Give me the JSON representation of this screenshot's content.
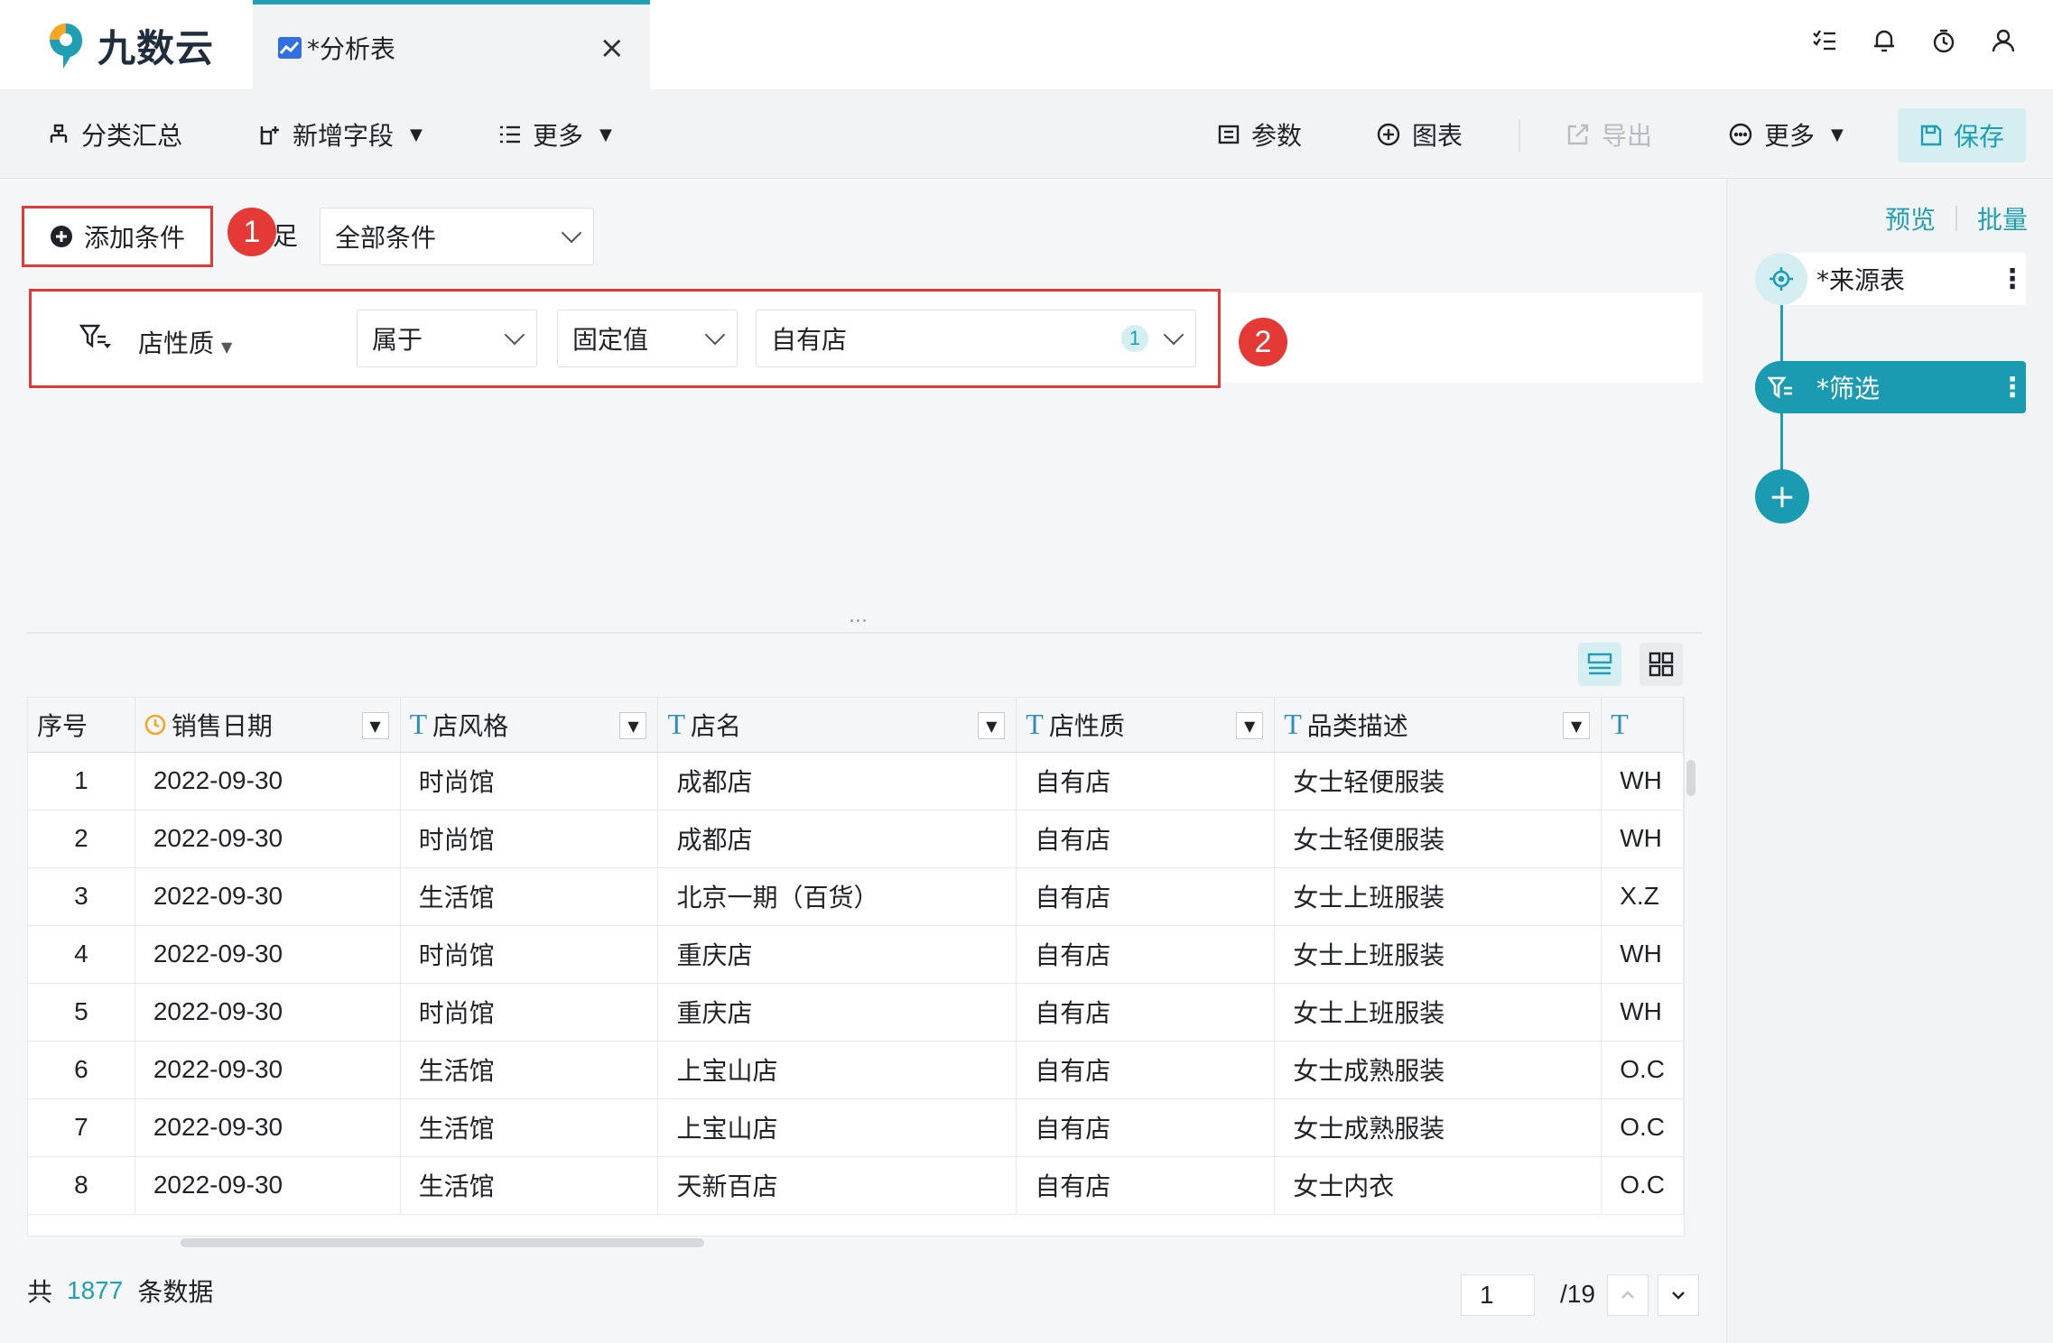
{
  "app": {
    "name": "九数云"
  },
  "tab": {
    "title": "*分析表"
  },
  "toolbar": {
    "group_summary": "分类汇总",
    "add_field": "新增字段",
    "more_left": "更多",
    "params": "参数",
    "chart": "图表",
    "export": "导出",
    "more_right": "更多",
    "save": "保存"
  },
  "filter": {
    "add_condition": "添加条件",
    "satisfy_partial": "足",
    "match_mode": "全部条件",
    "condition": {
      "field": "店性质",
      "operator": "属于",
      "value_type": "固定值",
      "value": "自有店",
      "value_count": "1"
    },
    "annotations": [
      "1",
      "2"
    ],
    "resizer": "..."
  },
  "table": {
    "columns": [
      {
        "label": "序号",
        "type": ""
      },
      {
        "label": "销售日期",
        "type": "date"
      },
      {
        "label": "店风格",
        "type": "T"
      },
      {
        "label": "店名",
        "type": "T"
      },
      {
        "label": "店性质",
        "type": "T"
      },
      {
        "label": "品类描述",
        "type": "T"
      },
      {
        "label": "",
        "type": "T"
      }
    ],
    "rows": [
      [
        "1",
        "2022-09-30",
        "时尚馆",
        "成都店",
        "自有店",
        "女士轻便服装",
        "WH"
      ],
      [
        "2",
        "2022-09-30",
        "时尚馆",
        "成都店",
        "自有店",
        "女士轻便服装",
        "WH"
      ],
      [
        "3",
        "2022-09-30",
        "生活馆",
        "北京一期（百货）",
        "自有店",
        "女士上班服装",
        "X.Z"
      ],
      [
        "4",
        "2022-09-30",
        "时尚馆",
        "重庆店",
        "自有店",
        "女士上班服装",
        "WH"
      ],
      [
        "5",
        "2022-09-30",
        "时尚馆",
        "重庆店",
        "自有店",
        "女士上班服装",
        "WH"
      ],
      [
        "6",
        "2022-09-30",
        "生活馆",
        "上宝山店",
        "自有店",
        "女士成熟服装",
        "O.C"
      ],
      [
        "7",
        "2022-09-30",
        "生活馆",
        "上宝山店",
        "自有店",
        "女士成熟服装",
        "O.C"
      ],
      [
        "8",
        "2022-09-30",
        "生活馆",
        "天新百店",
        "自有店",
        "女士内衣",
        "O.C"
      ]
    ]
  },
  "footer": {
    "prefix": "共",
    "count": "1877",
    "suffix": "条数据",
    "page": "1",
    "total_pages": "/19"
  },
  "right_panel": {
    "preview": "预览",
    "batch": "批量",
    "nodes": [
      {
        "label": "*来源表",
        "active": false
      },
      {
        "label": "*筛选",
        "active": true
      }
    ],
    "add": "+"
  },
  "colors": {
    "accent": "#1f9fb3",
    "annotation_red": "#e53935",
    "brand_blue": "#2f6fe0",
    "date_icon": "#f5a623"
  }
}
